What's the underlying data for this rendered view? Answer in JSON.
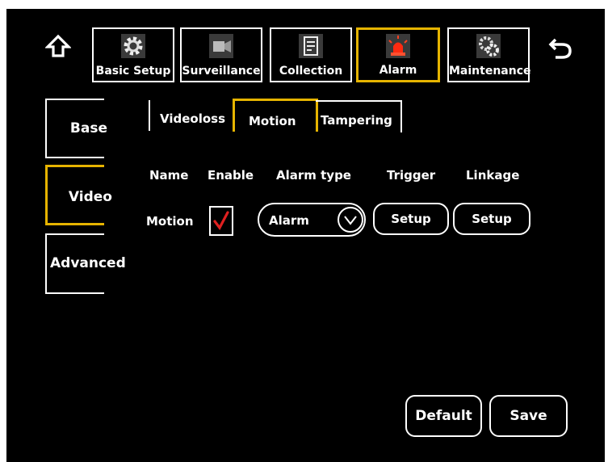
{
  "nav": {
    "tabs": [
      {
        "label": "Basic Setup",
        "icon": "gear-icon"
      },
      {
        "label": "Surveillance",
        "icon": "camera-icon"
      },
      {
        "label": "Collection",
        "icon": "storage-icon"
      },
      {
        "label": "Alarm",
        "icon": "siren-icon",
        "active": true
      },
      {
        "label": "Maintenance",
        "icon": "gears-icon"
      }
    ]
  },
  "sidebar": {
    "items": [
      {
        "label": "Base"
      },
      {
        "label": "Video",
        "active": true
      },
      {
        "label": "Advanced"
      }
    ]
  },
  "subtabs": [
    {
      "label": "Videoloss"
    },
    {
      "label": "Motion",
      "active": true
    },
    {
      "label": "Tampering"
    }
  ],
  "table": {
    "headers": [
      "Name",
      "Enable",
      "Alarm type",
      "Trigger",
      "Linkage"
    ],
    "row": {
      "name": "Motion",
      "enabled": true,
      "alarm_type": "Alarm",
      "trigger_button": "Setup",
      "linkage_button": "Setup"
    }
  },
  "footer": {
    "default_label": "Default",
    "save_label": "Save"
  },
  "colors": {
    "accent": "#e6b400",
    "check": "#e02020",
    "background": "#000000"
  }
}
